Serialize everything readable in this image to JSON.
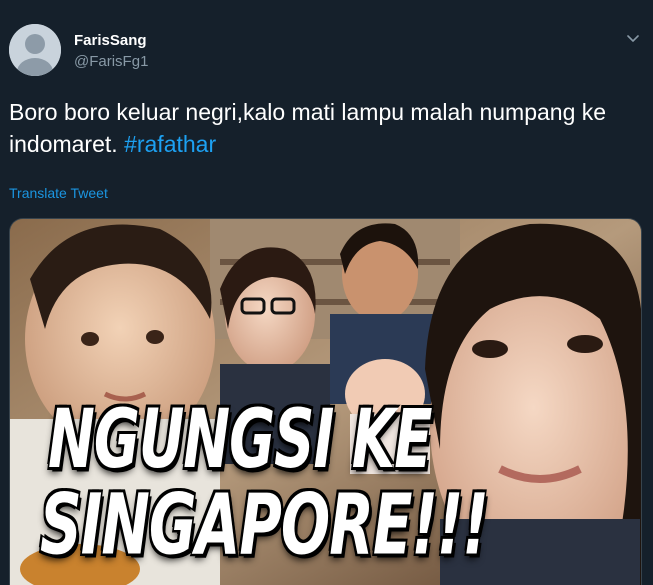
{
  "tweet": {
    "author_name": "FarisSang",
    "author_handle": "@FarisFg1",
    "text_before": "Boro boro keluar negri,kalo mati lampu malah numpang ke indomaret. ",
    "hashtag": "#rafathar",
    "translate_label": "Translate Tweet",
    "menu_icon": "chevron-down-icon",
    "avatar_icon": "default-avatar-icon"
  },
  "media": {
    "headline_line1": "NGUNGSI KE",
    "headline_line2": "SINGAPORE!!!"
  },
  "colors": {
    "background": "#15202b",
    "text": "#ffffff",
    "secondary": "#8899a6",
    "link": "#1da1f2",
    "translate": "#1b95e0"
  }
}
